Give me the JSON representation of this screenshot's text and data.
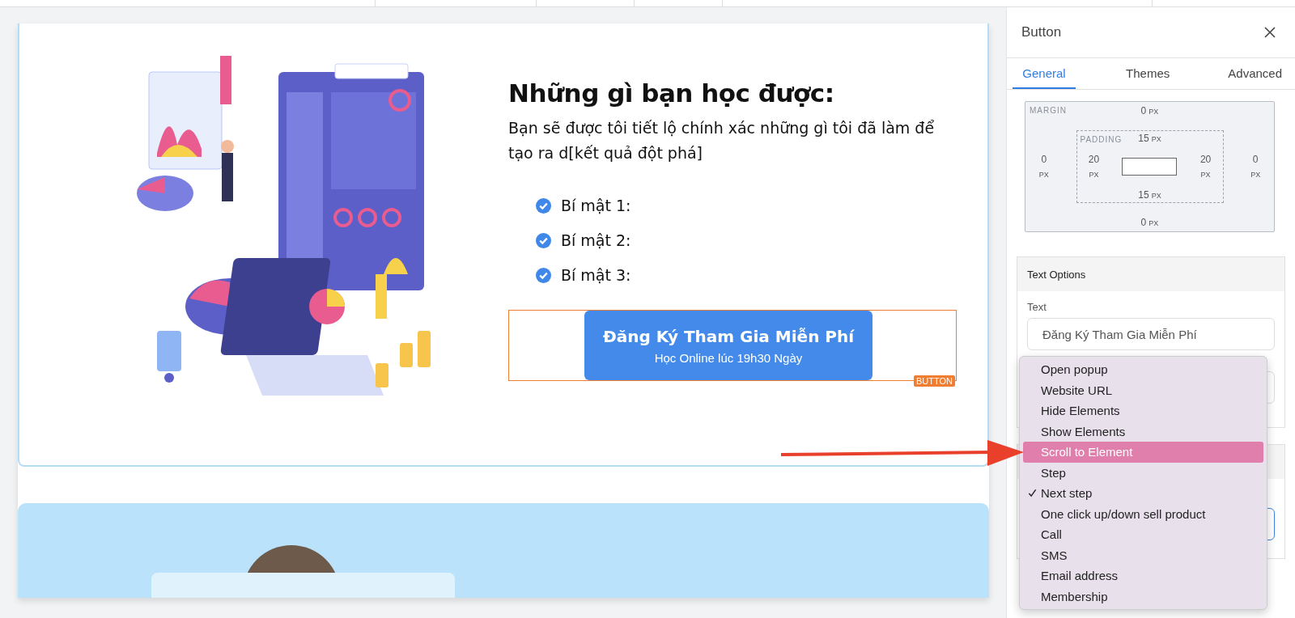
{
  "content": {
    "heading": "Những gì bạn học được:",
    "intro": "Bạn sẽ được tôi tiết lộ chính xác những gì tôi đã làm để tạo ra d[kết quả đột phá]",
    "bullets": [
      "Bí mật 1:",
      "Bí mật 2:",
      "Bí mật 3:"
    ],
    "cta": {
      "title": "Đăng Ký Tham Gia Miễn Phí",
      "subtitle": "Học Online lúc 19h30 Ngày"
    },
    "selection_tag": "BUTTON"
  },
  "panel": {
    "title": "Button",
    "tabs": [
      {
        "label": "General",
        "selected": true
      },
      {
        "label": "Themes",
        "selected": false
      },
      {
        "label": "Advanced",
        "selected": false
      }
    ],
    "box_model": {
      "margin_label": "MARGIN",
      "padding_label": "PADDING",
      "margin": {
        "top": {
          "value": "0",
          "unit": "PX"
        },
        "right": {
          "value": "0",
          "unit": "PX"
        },
        "bottom": {
          "value": "0",
          "unit": "PX"
        },
        "left": {
          "value": "0",
          "unit": "PX"
        }
      },
      "padding": {
        "top": {
          "value": "15",
          "unit": "PX"
        },
        "right": {
          "value": "20",
          "unit": "PX"
        },
        "bottom": {
          "value": "15",
          "unit": "PX"
        },
        "left": {
          "value": "20",
          "unit": "PX"
        }
      }
    },
    "text_options": {
      "title": "Text Options",
      "field_label": "Text",
      "field_value": "Đăng Ký Tham Gia Miễn Phí"
    }
  },
  "dropdown": [
    {
      "label": "Open popup",
      "selected": false,
      "checked": false
    },
    {
      "label": "Website URL",
      "selected": false,
      "checked": false
    },
    {
      "label": "Hide Elements",
      "selected": false,
      "checked": false
    },
    {
      "label": "Show Elements",
      "selected": false,
      "checked": false
    },
    {
      "label": "Scroll to Element",
      "selected": true,
      "checked": false
    },
    {
      "label": "Step",
      "selected": false,
      "checked": false
    },
    {
      "label": "Next step",
      "selected": false,
      "checked": true
    },
    {
      "label": "One click up/down sell product",
      "selected": false,
      "checked": false
    },
    {
      "label": "Call",
      "selected": false,
      "checked": false
    },
    {
      "label": "SMS",
      "selected": false,
      "checked": false
    },
    {
      "label": "Email address",
      "selected": false,
      "checked": false
    },
    {
      "label": "Membership",
      "selected": false,
      "checked": false
    }
  ]
}
